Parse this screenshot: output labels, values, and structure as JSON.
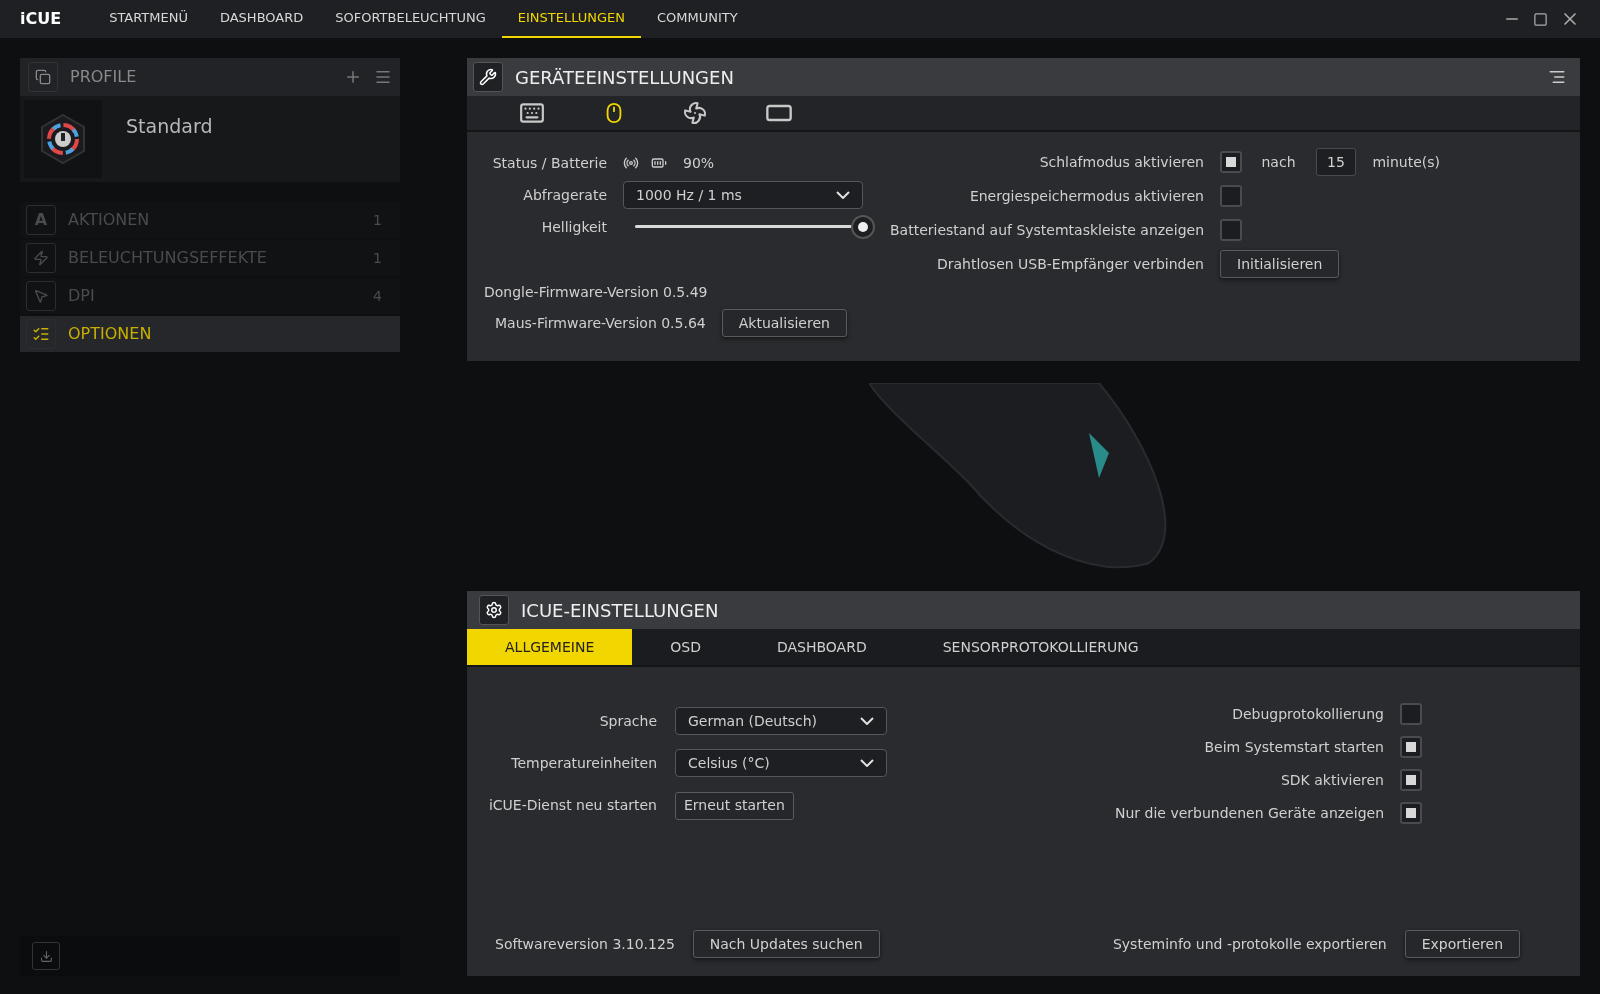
{
  "app": {
    "logo": "iCUE"
  },
  "nav": [
    {
      "label": "STARTMENÜ",
      "selected": false
    },
    {
      "label": "DASHBOARD",
      "selected": false
    },
    {
      "label": "SOFORTBELEUCHTUNG",
      "selected": false
    },
    {
      "label": "EINSTELLUNGEN",
      "selected": true
    },
    {
      "label": "COMMUNITY",
      "selected": false
    }
  ],
  "sidebar": {
    "title": "PROFILE",
    "profile": {
      "name": "Standard"
    },
    "items": [
      {
        "kind": "actions",
        "icon_text": "A",
        "label": "AKTIONEN",
        "count": "1",
        "selected": false
      },
      {
        "kind": "lighting",
        "label": "BELEUCHTUNGSEFFEKTE",
        "count": "1",
        "selected": false
      },
      {
        "kind": "dpi",
        "label": "DPI",
        "count": "4",
        "selected": false
      },
      {
        "kind": "options",
        "label": "OPTIONEN",
        "selected": true
      }
    ]
  },
  "device_settings": {
    "title": "GERÄTEEINSTELLUNGEN",
    "devices": [
      {
        "kind": "keyboard",
        "selected": false
      },
      {
        "kind": "mouse",
        "selected": true
      },
      {
        "kind": "cooler",
        "selected": false
      },
      {
        "kind": "strip",
        "selected": false
      }
    ],
    "status_label": "Status / Batterie",
    "battery": "90%",
    "polling_label": "Abfragerate",
    "polling_value": "1000 Hz / 1 ms",
    "brightness_label": "Helligkeit",
    "brightness": {
      "level": 0.99
    },
    "dongle_firmware": "Dongle-Firmware-Version 0.5.49",
    "mouse_firmware": "Maus-Firmware-Version 0.5.64",
    "update_button": "Aktualisieren",
    "sleep": {
      "label": "Schlafmodus aktivieren",
      "checked": true,
      "after": "nach",
      "minutes": "15",
      "unit": "minute(s)"
    },
    "options": [
      {
        "label": "Energiespeichermodus aktivieren",
        "checked": false
      },
      {
        "label": "Batteriestand auf Systemtaskleiste anzeigen",
        "checked": false
      }
    ],
    "receiver_label": "Drahtlosen USB-Empfänger verbinden",
    "receiver_button": "Initialisieren"
  },
  "icue_settings": {
    "title": "ICUE-EINSTELLUNGEN",
    "tabs": [
      {
        "label": "ALLGEMEINE",
        "selected": true
      },
      {
        "label": "OSD",
        "selected": false
      },
      {
        "label": "DASHBOARD",
        "selected": false
      },
      {
        "label": "SENSORPROTOKOLLIERUNG",
        "selected": false
      }
    ],
    "language_label": "Sprache",
    "language": "German (Deutsch)",
    "temperature_label": "Temperatureinheiten",
    "temperature": "Celsius (°C)",
    "restart_label": "iCUE-Dienst neu starten",
    "restart_button": "Erneut starten",
    "options": [
      {
        "label": "Debugprotokollierung",
        "checked": false
      },
      {
        "label": "Beim Systemstart starten",
        "checked": true
      },
      {
        "label": "SDK aktivieren",
        "checked": true
      },
      {
        "label": "Nur die verbundenen Geräte anzeigen",
        "checked": true
      }
    ],
    "version": "Softwareversion 3.10.125",
    "update_button": "Nach Updates suchen",
    "export_label": "Systeminfo und -protokolle exportieren",
    "export_button": "Exportieren"
  }
}
